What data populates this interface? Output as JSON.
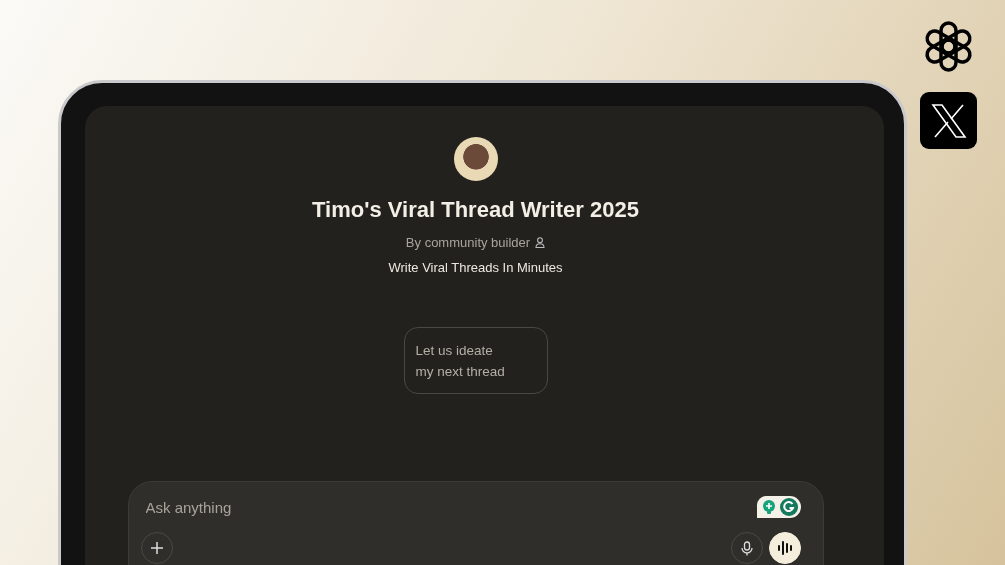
{
  "gpt": {
    "title": "Timo's Viral Thread Writer 2025",
    "byline": "By community builder",
    "tagline": "Write Viral Threads In Minutes"
  },
  "suggestions": [
    {
      "text": "Let us ideate my next thread"
    }
  ],
  "composer": {
    "placeholder": "Ask anything"
  }
}
